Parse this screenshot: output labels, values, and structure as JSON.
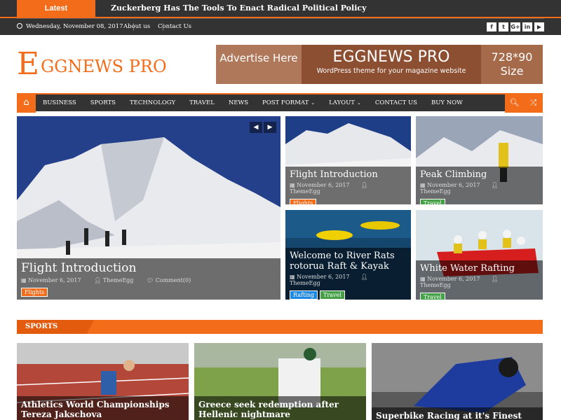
{
  "ticker": {
    "label": "Latest",
    "headline": "Zuckerberg Has The Tools To Enact Radical Political Policy"
  },
  "topbar": {
    "date": "Wednesday, November 08, 2017",
    "links": [
      "About us",
      "Contact Us"
    ],
    "social": [
      "f",
      "t",
      "G+",
      "in",
      "▶"
    ]
  },
  "logo": {
    "big": "E",
    "rest": "GGNEWS PRO"
  },
  "ad": {
    "left": "Advertise Here",
    "title": "EGGNEWS PRO",
    "subtitle": "WordPress theme for your magazine website",
    "size": "728*90 Size"
  },
  "nav": {
    "items": [
      {
        "label": "BUSINESS",
        "caret": ""
      },
      {
        "label": "SPORTS",
        "caret": ""
      },
      {
        "label": "TECHNOLOGY",
        "caret": ""
      },
      {
        "label": "TRAVEL",
        "caret": ""
      },
      {
        "label": "NEWS",
        "caret": ""
      },
      {
        "label": "POST FORMAT",
        "caret": "⌄"
      },
      {
        "label": "LAYOUT",
        "caret": "⌄"
      },
      {
        "label": "CONTACT US",
        "caret": ""
      },
      {
        "label": "BUY NOW",
        "caret": ""
      }
    ]
  },
  "featured": {
    "main": {
      "title": "Flight Introduction",
      "date": "November 6, 2017",
      "author": "ThemeEgg",
      "comments": "Comment(0)",
      "tags": [
        "Flights"
      ]
    },
    "c1": {
      "title": "Flight Introduction",
      "date": "November 6, 2017",
      "author": "ThemeEgg",
      "tags": [
        "Flights"
      ]
    },
    "c2": {
      "title": "Peak Climbing",
      "date": "November 6, 2017",
      "author": "ThemeEgg",
      "tags": [
        "Travel"
      ]
    },
    "c3": {
      "title": "Welcome to River Rats rotorua Raft & Kayak",
      "date": "November 6, 2017",
      "author": "ThemeEgg",
      "tags": [
        "Rafting",
        "Travel"
      ]
    },
    "c4": {
      "title": "White Water Rafting",
      "date": "November 6, 2017",
      "author": "ThemeEgg",
      "tags": [
        "Travel"
      ]
    }
  },
  "sports": {
    "label": "SPORTS",
    "cards": [
      {
        "title": "Athletics World Championships Tereza Jakschova"
      },
      {
        "title": "Greece seek redemption after Hellenic nightmare"
      },
      {
        "title": "Superbike Racing at it's Finest"
      }
    ]
  },
  "colors": {
    "accent": "#f26c1a",
    "dark": "#333333"
  }
}
